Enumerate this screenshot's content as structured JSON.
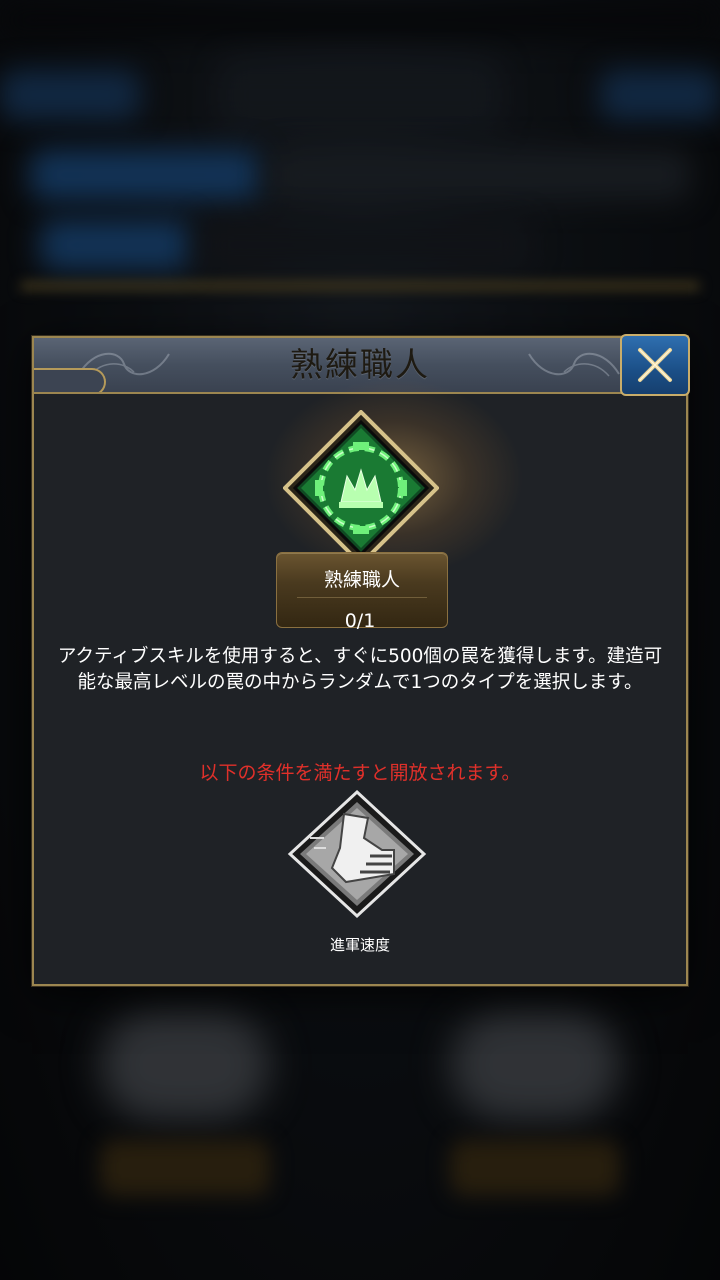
{
  "dialog": {
    "title": "熟練職人",
    "close_icon": "close-x-icon"
  },
  "skill": {
    "icon": "chained-trap-icon",
    "name": "熟練職人",
    "level": "0/1",
    "description": "アクティブスキルを使用すると、すぐに500個の罠を獲得します。建造可能な最高レベルの罠の中からランダムで1つのタイプを選択します。"
  },
  "unlock": {
    "condition_text": "以下の条件を満たすと開放されます。",
    "requirement": {
      "icon": "march-speed-boot-icon",
      "name": "進軍速度"
    }
  },
  "colors": {
    "accent_gold": "#9c8650",
    "condition_red": "#e0302a",
    "icon_green": "#1f9a3a",
    "close_blue": "#1b4f87"
  }
}
